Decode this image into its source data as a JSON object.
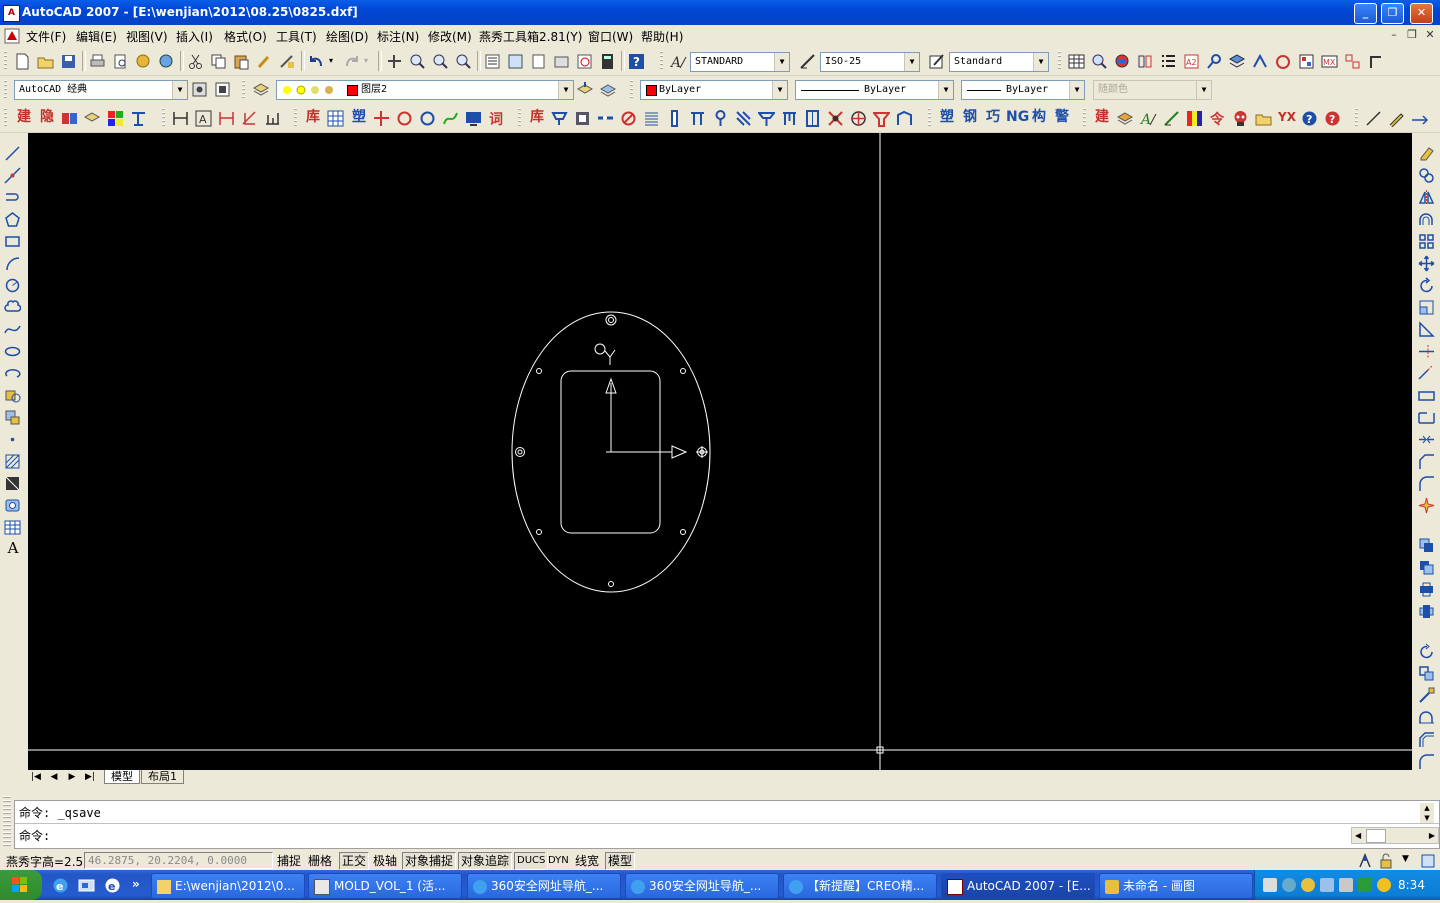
{
  "window": {
    "title": "AutoCAD 2007 - [E:\\wenjian\\2012\\08.25\\0825.dxf]",
    "app_icon_text": "A",
    "minimize_glyph": "_",
    "maximize_glyph": "❐",
    "close_glyph": "✕"
  },
  "menu": {
    "items": [
      "文件(F)",
      "编辑(E)",
      "视图(V)",
      "插入(I)",
      "格式(O)",
      "工具(T)",
      "绘图(D)",
      "标注(N)",
      "修改(M)",
      "燕秀工具箱2.81(Y)",
      "窗口(W)",
      "帮助(H)"
    ],
    "mdi_min": "–",
    "mdi_restore": "❐",
    "mdi_close": "✕"
  },
  "toolbar_styles": {
    "text_style": "STANDARD",
    "dim_style": "ISO-25",
    "table_style": "Standard"
  },
  "toolbar_layers": {
    "workspace": "AutoCAD 经典",
    "layer": "图层2",
    "layer_color": "#ff0000",
    "color": "ByLayer",
    "linetype": "ByLayer",
    "lineweight": "ByLayer",
    "plotstyle": "随颜色"
  },
  "yanxiu_toolbar": {
    "group1": [
      "建",
      "隐"
    ],
    "group2": [
      "库",
      "塑"
    ],
    "group3": [
      "库"
    ],
    "group4": [
      "塑",
      "钢",
      "巧",
      "NG",
      "构",
      "警"
    ],
    "group5": [
      "建"
    ],
    "yx": "YX"
  },
  "left_toolbar_text_tool": "A",
  "layout_tabs": [
    "模型",
    "布局1"
  ],
  "tab_nav": [
    "|◀",
    "◀",
    "▶",
    "▶|"
  ],
  "command": {
    "line1": "命令: _qsave",
    "line2": "命令:"
  },
  "status": {
    "label": "燕秀字高=2.5",
    "coords": "46.2875,  20.2204,  0.0000",
    "buttons": [
      {
        "label": "捕捉",
        "on": false
      },
      {
        "label": "栅格",
        "on": false
      },
      {
        "label": "正交",
        "on": true
      },
      {
        "label": "极轴",
        "on": false
      },
      {
        "label": "对象捕捉",
        "on": true
      },
      {
        "label": "对象追踪",
        "on": true
      },
      {
        "label": "DUCS",
        "on": true
      },
      {
        "label": "DYN",
        "on": false
      },
      {
        "label": "线宽",
        "on": false
      },
      {
        "label": "模型",
        "on": true
      }
    ]
  },
  "taskbar": {
    "tasks": [
      {
        "label": "E:\\wenjian\\2012\\0...",
        "active": false
      },
      {
        "label": "MOLD_VOL_1 (活...",
        "active": false
      },
      {
        "label": "360安全网址导航_...",
        "active": false
      },
      {
        "label": "360安全网址导航_...",
        "active": false
      },
      {
        "label": "【新提醒】CREO精...",
        "active": false
      },
      {
        "label": "AutoCAD 2007 - [E...",
        "active": true
      },
      {
        "label": "未命名 - 画图",
        "active": false
      }
    ],
    "clock": "8:34",
    "quicklaunch_more": "»"
  },
  "colors": {
    "canvas": "#000000",
    "title_bar": "#0a5ee8",
    "taskbar": "#245ccf",
    "tray": "#0c8fe8",
    "start": "#2e8b2e"
  }
}
